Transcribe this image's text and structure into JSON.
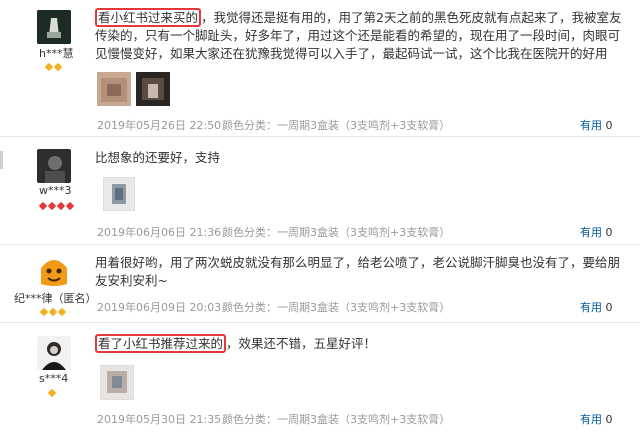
{
  "reviews": [
    {
      "user": "h***慧",
      "highlight": "看小红书过来买的",
      "text": "，我觉得还是挺有用的，用了第2天之前的黑色死皮就有点起来了，我被室友传染的，只有一个脚趾头，好多年了，用过这个还是能看的希望的，现在用了一段时间，肉眼可见慢慢变好，如果大家还在犹豫我觉得可以入手了，最起码试一试，这个比我在医院开的好用",
      "date": "2019年05月26日 22:50",
      "color": "颜色分类：一周期3盒装（3支鸣剂+3支软膏）",
      "useful": "有用",
      "useful_count": "0"
    },
    {
      "user": "w***3",
      "text": "比想象的还要好，支持",
      "date": "2019年06月06日 21:36",
      "color": "颜色分类：一周期3盒装（3支鸣剂+3支软膏）",
      "useful": "有用",
      "useful_count": "0"
    },
    {
      "user": "纪***律（匿名）",
      "text": "用着很好哟，用了两次蜕皮就没有那么明显了，给老公喷了，老公说脚汗脚臭也没有了，要给朋友安利安利~",
      "date": "2019年06月09日 20:03",
      "color": "颜色分类：一周期3盒装（3支鸣剂+3支软膏）",
      "useful": "有用",
      "useful_count": "0"
    },
    {
      "user": "s***4",
      "highlight": "看了小红书推荐过来的",
      "text": "，效果还不错，五星好评！",
      "date": "2019年05月30日 21:35",
      "color": "颜色分类：一周期3盒装（3支鸣剂+3支软膏）",
      "useful": "有用",
      "useful_count": "0"
    }
  ],
  "colors": {
    "link": "#005aa0",
    "highlight_border": "#e4393c",
    "level_gold": "#f2b01e",
    "level_red": "#e4393c"
  }
}
